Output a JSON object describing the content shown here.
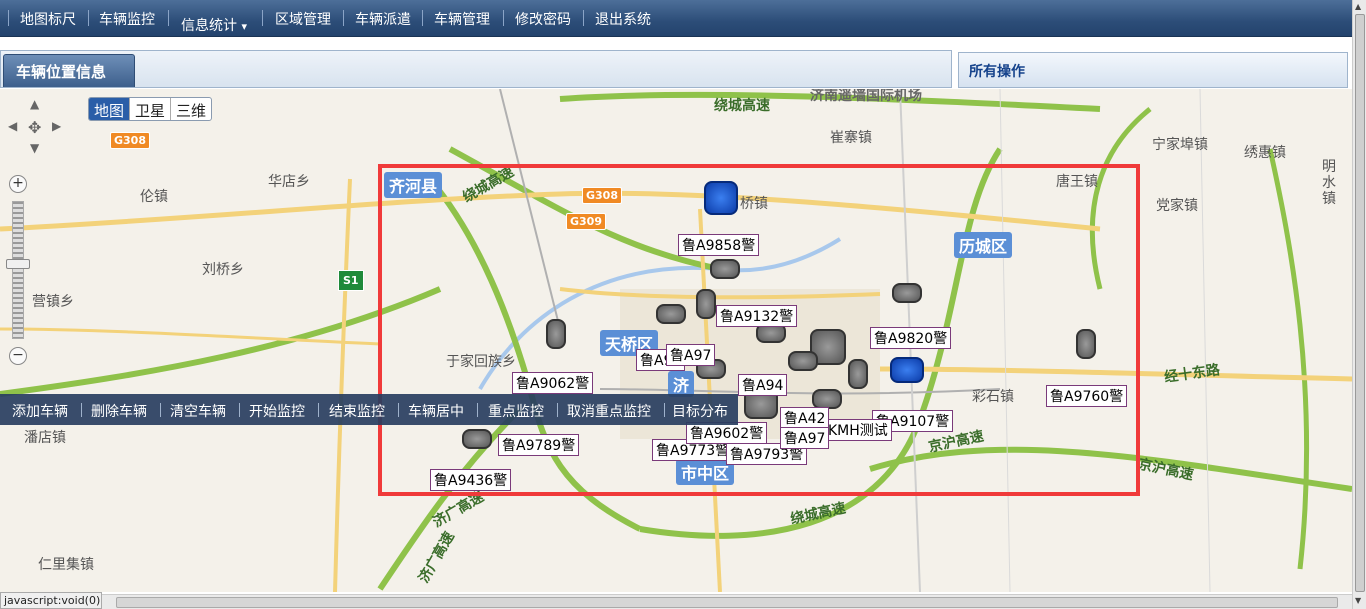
{
  "nav": {
    "items": [
      "地图标尺",
      "车辆监控",
      "信息统计",
      "区域管理",
      "车辆派遣",
      "车辆管理",
      "修改密码",
      "退出系统"
    ],
    "dropdown_marker": "▾"
  },
  "tabs": {
    "vehicle_position": "车辆位置信息"
  },
  "ops_panel": {
    "title": "所有操作"
  },
  "map_controls": {
    "map_types": [
      "地图",
      "卫星",
      "三维"
    ],
    "selected_map_type": "地图",
    "zoom_in": "+",
    "zoom_out": "−"
  },
  "map": {
    "places": [
      "华店乡",
      "伦镇",
      "刘桥乡",
      "营镇乡",
      "于家回族乡",
      "潘店镇",
      "仁里集镇",
      "崔寨镇",
      "唐王镇",
      "宁家埠镇",
      "绣惠镇",
      "党家镇",
      "彩石镇",
      "明水镇",
      "桥镇"
    ],
    "districts": [
      "齐河县",
      "天桥区",
      "历城区",
      "市中区",
      "济"
    ],
    "highways": [
      "绕城高速",
      "绕城高速",
      "京沪高速",
      "京沪高速",
      "经十东路",
      "济广高速",
      "济广高速",
      "绕城高速",
      "济南遥墙国际机场"
    ],
    "road_shields": [
      "G308",
      "G308",
      "G309",
      "S1"
    ],
    "plates": [
      "鲁A9858警",
      "鲁A9132警",
      "鲁A9820警",
      "鲁A9760警",
      "鲁A9062警",
      "鲁A9789警",
      "鲁A9436警",
      "鲁A9773警",
      "鲁A9793警",
      "鲁A9602警",
      "鲁A9107警",
      "KMH测试",
      "鲁A97",
      "鲁A97",
      "鲁A94",
      "鲁A42",
      "鲁A97"
    ]
  },
  "actions": [
    "添加车辆",
    "删除车辆",
    "清空车辆",
    "开始监控",
    "结束监控",
    "车辆居中",
    "重点监控",
    "取消重点监控",
    "目标分布"
  ],
  "status_text": "javascript:void(0)",
  "colors": {
    "nav_bg": "#2c4d78",
    "highlight_box": "#f03a3a",
    "district_label": "#5b8fd6"
  }
}
